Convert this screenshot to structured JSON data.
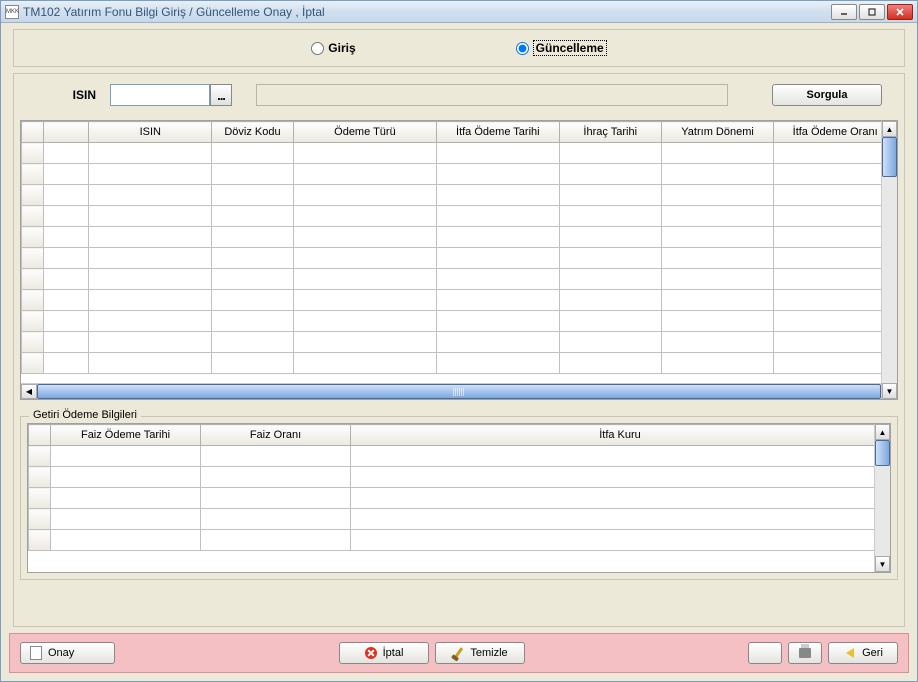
{
  "window": {
    "title": "TM102 Yatırım Fonu Bilgi Giriş / Güncelleme Onay , İptal"
  },
  "mode": {
    "giris_label": "Giriş",
    "guncelleme_label": "Güncelleme",
    "selected": "guncelleme"
  },
  "search": {
    "isin_label": "ISIN",
    "isin_value": "",
    "sorgula_label": "Sorgula"
  },
  "grid1": {
    "columns": [
      "ISIN",
      "Döviz Kodu",
      "Ödeme Türü",
      "İtfa Ödeme Tarihi",
      "İhraç Tarihi",
      "Yatrım Dönemi",
      "İtfa Ödeme Oranı"
    ],
    "rows": [
      [
        "",
        "",
        "",
        "",
        "",
        "",
        ""
      ],
      [
        "",
        "",
        "",
        "",
        "",
        "",
        ""
      ],
      [
        "",
        "",
        "",
        "",
        "",
        "",
        ""
      ],
      [
        "",
        "",
        "",
        "",
        "",
        "",
        ""
      ],
      [
        "",
        "",
        "",
        "",
        "",
        "",
        ""
      ],
      [
        "",
        "",
        "",
        "",
        "",
        "",
        ""
      ],
      [
        "",
        "",
        "",
        "",
        "",
        "",
        ""
      ],
      [
        "",
        "",
        "",
        "",
        "",
        "",
        ""
      ],
      [
        "",
        "",
        "",
        "",
        "",
        "",
        ""
      ],
      [
        "",
        "",
        "",
        "",
        "",
        "",
        ""
      ],
      [
        "",
        "",
        "",
        "",
        "",
        "",
        ""
      ]
    ]
  },
  "grid2": {
    "legend": "Getiri Ödeme Bilgileri",
    "columns": [
      "Faiz Ödeme Tarihi",
      "Faiz Oranı",
      "İtfa Kuru"
    ],
    "rows": [
      [
        "",
        "",
        ""
      ],
      [
        "",
        "",
        ""
      ],
      [
        "",
        "",
        ""
      ],
      [
        "",
        "",
        ""
      ],
      [
        "",
        "",
        ""
      ]
    ]
  },
  "footer": {
    "onay": "Onay",
    "iptal": "İptal",
    "temizle": "Temizle",
    "geri": "Geri"
  }
}
